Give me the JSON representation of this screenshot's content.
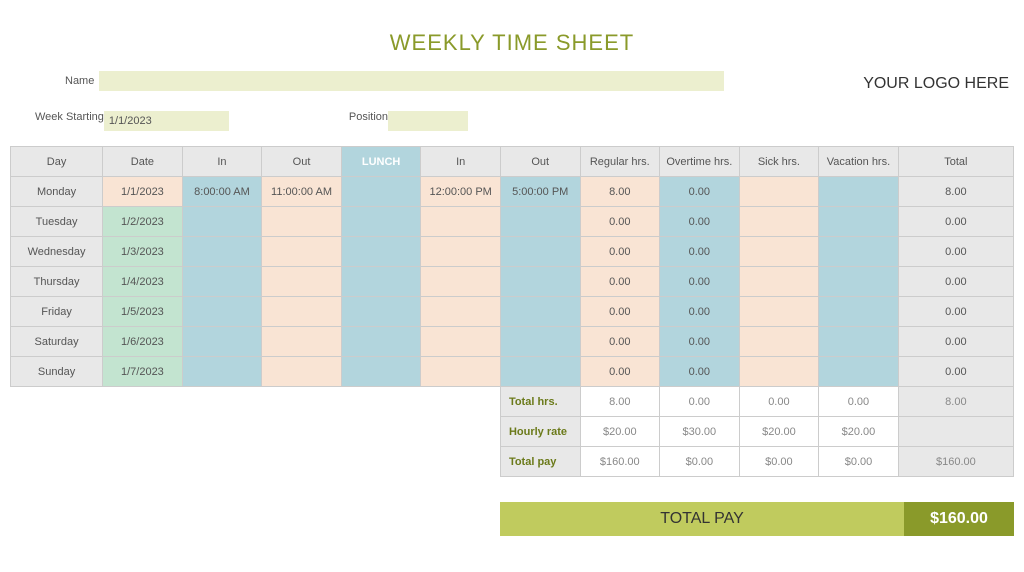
{
  "title": "WEEKLY TIME SHEET",
  "logo_text": "YOUR LOGO HERE",
  "labels": {
    "name": "Name",
    "week_starting": "Week Starting",
    "position": "Position"
  },
  "fields": {
    "name": "",
    "week_starting": "1/1/2023",
    "position": ""
  },
  "headers": {
    "day": "Day",
    "date": "Date",
    "in1": "In",
    "out1": "Out",
    "lunch": "LUNCH",
    "in2": "In",
    "out2": "Out",
    "regular": "Regular hrs.",
    "overtime": "Overtime hrs.",
    "sick": "Sick hrs.",
    "vacation": "Vacation hrs.",
    "total": "Total"
  },
  "rows": [
    {
      "day": "Monday",
      "date": "1/1/2023",
      "date_class": "col-date",
      "in1": "8:00:00 AM",
      "out1": "11:00:00 AM",
      "lunch": "",
      "in2": "12:00:00 PM",
      "out2": "5:00:00 PM",
      "regular": "8.00",
      "overtime": "0.00",
      "sick": "",
      "vacation": "",
      "total": "8.00"
    },
    {
      "day": "Tuesday",
      "date": "1/2/2023",
      "date_class": "col-date-green",
      "in1": "",
      "out1": "",
      "lunch": "",
      "in2": "",
      "out2": "",
      "regular": "0.00",
      "overtime": "0.00",
      "sick": "",
      "vacation": "",
      "total": "0.00"
    },
    {
      "day": "Wednesday",
      "date": "1/3/2023",
      "date_class": "col-date-green",
      "in1": "",
      "out1": "",
      "lunch": "",
      "in2": "",
      "out2": "",
      "regular": "0.00",
      "overtime": "0.00",
      "sick": "",
      "vacation": "",
      "total": "0.00"
    },
    {
      "day": "Thursday",
      "date": "1/4/2023",
      "date_class": "col-date-green",
      "in1": "",
      "out1": "",
      "lunch": "",
      "in2": "",
      "out2": "",
      "regular": "0.00",
      "overtime": "0.00",
      "sick": "",
      "vacation": "",
      "total": "0.00"
    },
    {
      "day": "Friday",
      "date": "1/5/2023",
      "date_class": "col-date-green",
      "in1": "",
      "out1": "",
      "lunch": "",
      "in2": "",
      "out2": "",
      "regular": "0.00",
      "overtime": "0.00",
      "sick": "",
      "vacation": "",
      "total": "0.00"
    },
    {
      "day": "Saturday",
      "date": "1/6/2023",
      "date_class": "col-date-green",
      "in1": "",
      "out1": "",
      "lunch": "",
      "in2": "",
      "out2": "",
      "regular": "0.00",
      "overtime": "0.00",
      "sick": "",
      "vacation": "",
      "total": "0.00"
    },
    {
      "day": "Sunday",
      "date": "1/7/2023",
      "date_class": "col-date-green",
      "in1": "",
      "out1": "",
      "lunch": "",
      "in2": "",
      "out2": "",
      "regular": "0.00",
      "overtime": "0.00",
      "sick": "",
      "vacation": "",
      "total": "0.00"
    }
  ],
  "summary": {
    "total_hrs_label": "Total hrs.",
    "hourly_rate_label": "Hourly rate",
    "total_pay_label": "Total pay",
    "total_hrs": {
      "regular": "8.00",
      "overtime": "0.00",
      "sick": "0.00",
      "vacation": "0.00",
      "total": "8.00"
    },
    "hourly_rate": {
      "regular": "$20.00",
      "overtime": "$30.00",
      "sick": "$20.00",
      "vacation": "$20.00",
      "total": ""
    },
    "total_pay": {
      "regular": "$160.00",
      "overtime": "$0.00",
      "sick": "$0.00",
      "vacation": "$0.00",
      "total": "$160.00"
    }
  },
  "grand_total": {
    "label": "TOTAL PAY",
    "amount": "$160.00"
  }
}
